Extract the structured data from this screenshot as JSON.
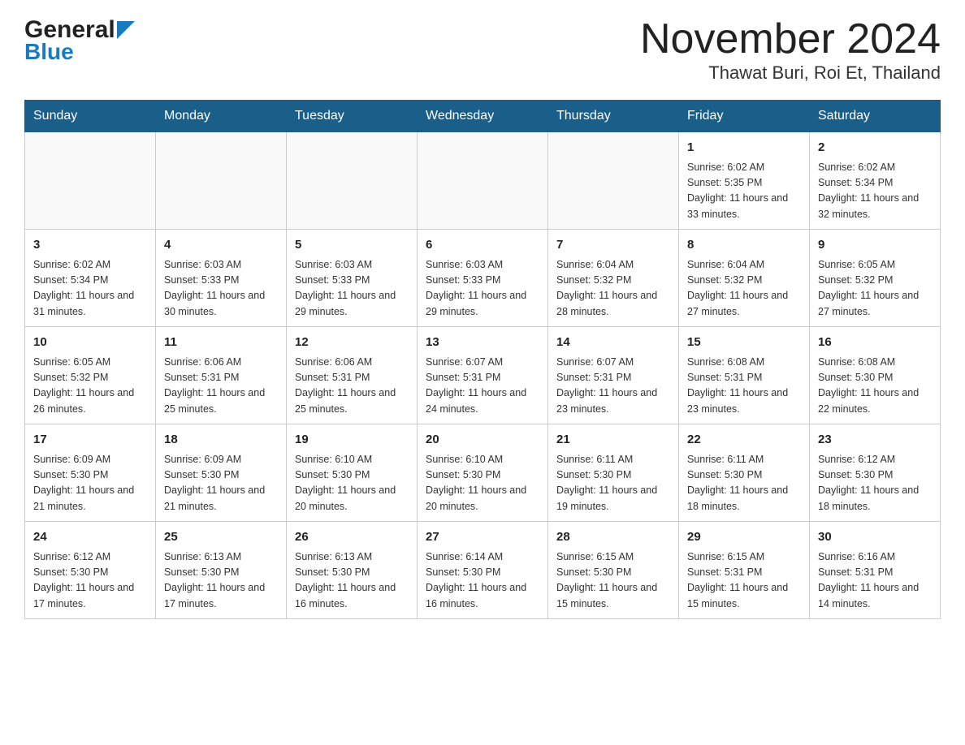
{
  "header": {
    "logo_general": "General",
    "logo_blue": "Blue",
    "month_title": "November 2024",
    "location": "Thawat Buri, Roi Et, Thailand"
  },
  "days_of_week": [
    "Sunday",
    "Monday",
    "Tuesday",
    "Wednesday",
    "Thursday",
    "Friday",
    "Saturday"
  ],
  "weeks": [
    [
      {
        "day": "",
        "info": ""
      },
      {
        "day": "",
        "info": ""
      },
      {
        "day": "",
        "info": ""
      },
      {
        "day": "",
        "info": ""
      },
      {
        "day": "",
        "info": ""
      },
      {
        "day": "1",
        "info": "Sunrise: 6:02 AM\nSunset: 5:35 PM\nDaylight: 11 hours and 33 minutes."
      },
      {
        "day": "2",
        "info": "Sunrise: 6:02 AM\nSunset: 5:34 PM\nDaylight: 11 hours and 32 minutes."
      }
    ],
    [
      {
        "day": "3",
        "info": "Sunrise: 6:02 AM\nSunset: 5:34 PM\nDaylight: 11 hours and 31 minutes."
      },
      {
        "day": "4",
        "info": "Sunrise: 6:03 AM\nSunset: 5:33 PM\nDaylight: 11 hours and 30 minutes."
      },
      {
        "day": "5",
        "info": "Sunrise: 6:03 AM\nSunset: 5:33 PM\nDaylight: 11 hours and 29 minutes."
      },
      {
        "day": "6",
        "info": "Sunrise: 6:03 AM\nSunset: 5:33 PM\nDaylight: 11 hours and 29 minutes."
      },
      {
        "day": "7",
        "info": "Sunrise: 6:04 AM\nSunset: 5:32 PM\nDaylight: 11 hours and 28 minutes."
      },
      {
        "day": "8",
        "info": "Sunrise: 6:04 AM\nSunset: 5:32 PM\nDaylight: 11 hours and 27 minutes."
      },
      {
        "day": "9",
        "info": "Sunrise: 6:05 AM\nSunset: 5:32 PM\nDaylight: 11 hours and 27 minutes."
      }
    ],
    [
      {
        "day": "10",
        "info": "Sunrise: 6:05 AM\nSunset: 5:32 PM\nDaylight: 11 hours and 26 minutes."
      },
      {
        "day": "11",
        "info": "Sunrise: 6:06 AM\nSunset: 5:31 PM\nDaylight: 11 hours and 25 minutes."
      },
      {
        "day": "12",
        "info": "Sunrise: 6:06 AM\nSunset: 5:31 PM\nDaylight: 11 hours and 25 minutes."
      },
      {
        "day": "13",
        "info": "Sunrise: 6:07 AM\nSunset: 5:31 PM\nDaylight: 11 hours and 24 minutes."
      },
      {
        "day": "14",
        "info": "Sunrise: 6:07 AM\nSunset: 5:31 PM\nDaylight: 11 hours and 23 minutes."
      },
      {
        "day": "15",
        "info": "Sunrise: 6:08 AM\nSunset: 5:31 PM\nDaylight: 11 hours and 23 minutes."
      },
      {
        "day": "16",
        "info": "Sunrise: 6:08 AM\nSunset: 5:30 PM\nDaylight: 11 hours and 22 minutes."
      }
    ],
    [
      {
        "day": "17",
        "info": "Sunrise: 6:09 AM\nSunset: 5:30 PM\nDaylight: 11 hours and 21 minutes."
      },
      {
        "day": "18",
        "info": "Sunrise: 6:09 AM\nSunset: 5:30 PM\nDaylight: 11 hours and 21 minutes."
      },
      {
        "day": "19",
        "info": "Sunrise: 6:10 AM\nSunset: 5:30 PM\nDaylight: 11 hours and 20 minutes."
      },
      {
        "day": "20",
        "info": "Sunrise: 6:10 AM\nSunset: 5:30 PM\nDaylight: 11 hours and 20 minutes."
      },
      {
        "day": "21",
        "info": "Sunrise: 6:11 AM\nSunset: 5:30 PM\nDaylight: 11 hours and 19 minutes."
      },
      {
        "day": "22",
        "info": "Sunrise: 6:11 AM\nSunset: 5:30 PM\nDaylight: 11 hours and 18 minutes."
      },
      {
        "day": "23",
        "info": "Sunrise: 6:12 AM\nSunset: 5:30 PM\nDaylight: 11 hours and 18 minutes."
      }
    ],
    [
      {
        "day": "24",
        "info": "Sunrise: 6:12 AM\nSunset: 5:30 PM\nDaylight: 11 hours and 17 minutes."
      },
      {
        "day": "25",
        "info": "Sunrise: 6:13 AM\nSunset: 5:30 PM\nDaylight: 11 hours and 17 minutes."
      },
      {
        "day": "26",
        "info": "Sunrise: 6:13 AM\nSunset: 5:30 PM\nDaylight: 11 hours and 16 minutes."
      },
      {
        "day": "27",
        "info": "Sunrise: 6:14 AM\nSunset: 5:30 PM\nDaylight: 11 hours and 16 minutes."
      },
      {
        "day": "28",
        "info": "Sunrise: 6:15 AM\nSunset: 5:30 PM\nDaylight: 11 hours and 15 minutes."
      },
      {
        "day": "29",
        "info": "Sunrise: 6:15 AM\nSunset: 5:31 PM\nDaylight: 11 hours and 15 minutes."
      },
      {
        "day": "30",
        "info": "Sunrise: 6:16 AM\nSunset: 5:31 PM\nDaylight: 11 hours and 14 minutes."
      }
    ]
  ]
}
